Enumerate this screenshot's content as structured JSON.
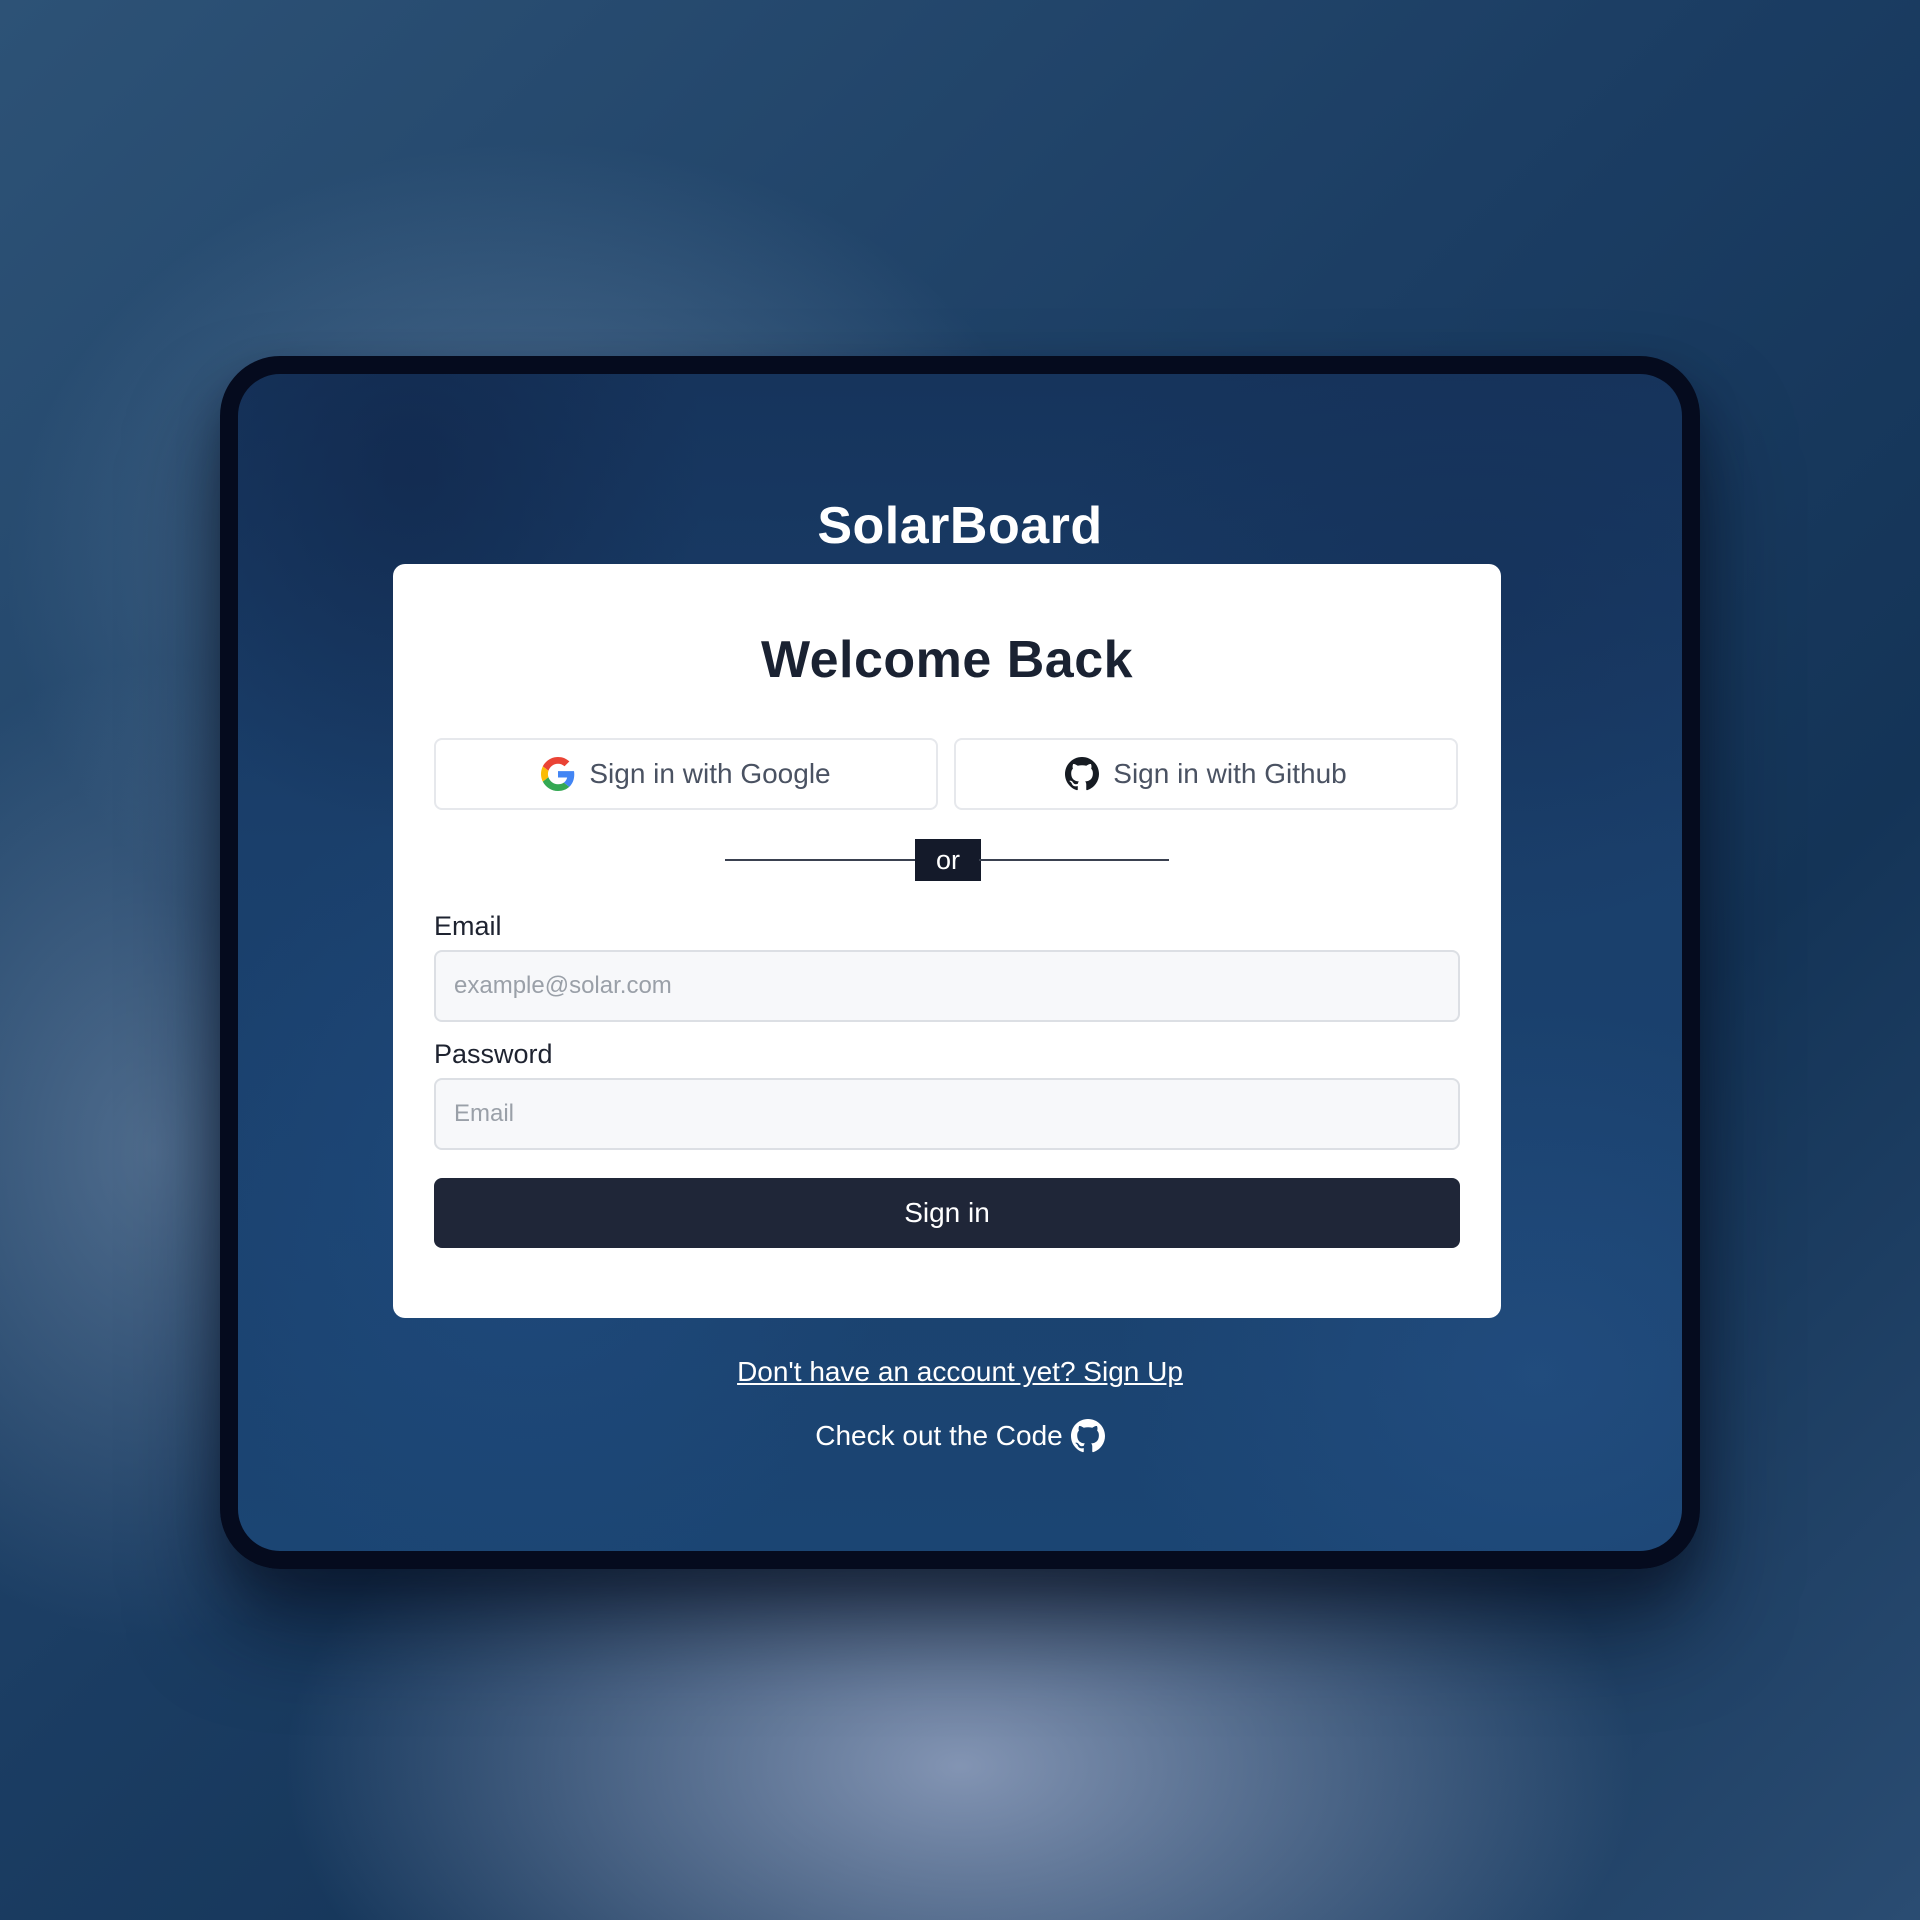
{
  "app": {
    "brand": "SolarBoard"
  },
  "login": {
    "title": "Welcome Back",
    "google_button": "Sign in with Google",
    "github_button": "Sign in with Github",
    "divider_text": "or",
    "email_label": "Email",
    "email_placeholder": "example@solar.com",
    "password_label": "Password",
    "password_placeholder": "Email",
    "submit_label": "Sign in"
  },
  "footer": {
    "signup_link": "Don't have an account yet? Sign Up",
    "code_link": "Check out the Code"
  },
  "icons": {
    "google": "google-icon",
    "github": "github-icon"
  },
  "colors": {
    "submit_button": "#1f2638",
    "divider_badge": "#141a2a",
    "frame_border": "#050b1e"
  }
}
